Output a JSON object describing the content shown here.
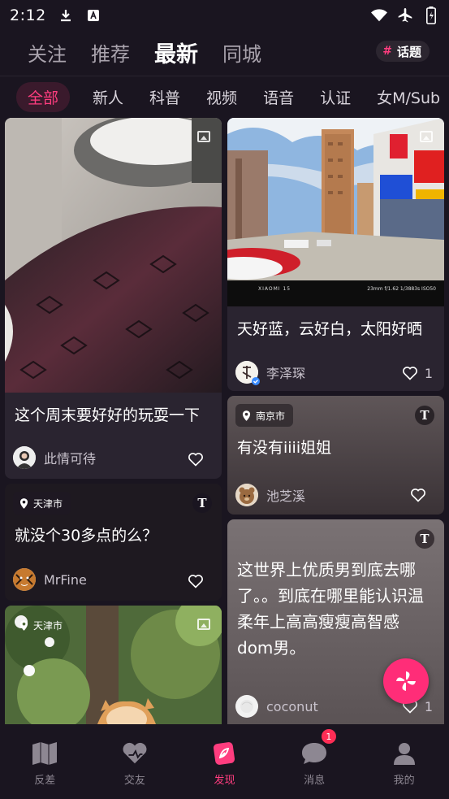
{
  "status_bar": {
    "time": "2:12"
  },
  "top_nav": {
    "tabs": [
      {
        "label": "关注",
        "active": false
      },
      {
        "label": "推荐",
        "active": false
      },
      {
        "label": "最新",
        "active": true
      },
      {
        "label": "同城",
        "active": false
      }
    ],
    "topic_button": {
      "hash": "#",
      "label": "话题"
    }
  },
  "sub_tabs": [
    "全部",
    "新人",
    "科普",
    "视频",
    "语音",
    "认证",
    "女M/Sub"
  ],
  "cards": {
    "left1": {
      "title": "这个周末要好好的玩耍一下",
      "author": "此情可待",
      "likes": ""
    },
    "left2": {
      "location": "天津市",
      "title": "就没个30多点的么？",
      "author": "MrFine",
      "likes": ""
    },
    "left3": {
      "location": "天津市"
    },
    "right1": {
      "title": "天好蓝，云好白，太阳好晒",
      "author": "李泽琛",
      "likes": "1",
      "watermark_model": "XIAOMI 15",
      "watermark_params": "23mm f/1.62 1/3883s ISO50"
    },
    "right2": {
      "location": "南京市",
      "title": "有没有iiii姐姐",
      "author": "池芝溪",
      "likes": ""
    },
    "right3": {
      "title": "这世界上优质男到底去哪了。。到底在哪里能认识温柔年上高高瘦瘦高智感dom男。",
      "author": "coconut",
      "likes": "1"
    }
  },
  "bottom_nav": [
    {
      "label": "反差",
      "icon": "book-icon",
      "active": false
    },
    {
      "label": "交友",
      "icon": "heart-icon",
      "active": false
    },
    {
      "label": "发现",
      "icon": "discover-icon",
      "active": true
    },
    {
      "label": "消息",
      "icon": "chat-icon",
      "active": false,
      "badge": "1"
    },
    {
      "label": "我的",
      "icon": "profile-icon",
      "active": false
    }
  ],
  "colors": {
    "accent": "#ff3d7f",
    "background": "#1a1520",
    "card": "#2a2430"
  }
}
